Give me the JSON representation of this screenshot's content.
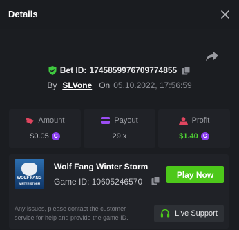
{
  "header": {
    "title": "Details",
    "close_icon": "close-icon"
  },
  "bet": {
    "id_label": "Bet ID:",
    "id": "1745859976709774855",
    "by_label": "By",
    "user": "SLVone",
    "on_label": "On",
    "timestamp": "05.10.2022, 17:56:59"
  },
  "stats": {
    "amount": {
      "label": "Amount",
      "value": "$0.05"
    },
    "payout": {
      "label": "Payout",
      "value": "29 x"
    },
    "profit": {
      "label": "Profit",
      "value": "$1.40"
    }
  },
  "coin_symbol": "C",
  "game": {
    "thumb_line1": "WOLF FANG",
    "thumb_line2": "WINTER STORM",
    "name": "Wolf Fang Winter Storm",
    "id_label": "Game ID:",
    "id": "10605246570",
    "play_label": "Play Now"
  },
  "support": {
    "notice": "Any issues, please contact the customer service for help and provide the game ID.",
    "live_label": "Live Support"
  },
  "colors": {
    "background": "#1b1d21",
    "card": "#202227",
    "accent_green": "#4dc81a",
    "profit_green": "#4fd333",
    "coin_purple": "#8b3ff1",
    "amount_icon": "#e0455f",
    "payout_icon": "#9a4df2",
    "profit_icon": "#e0455f"
  }
}
